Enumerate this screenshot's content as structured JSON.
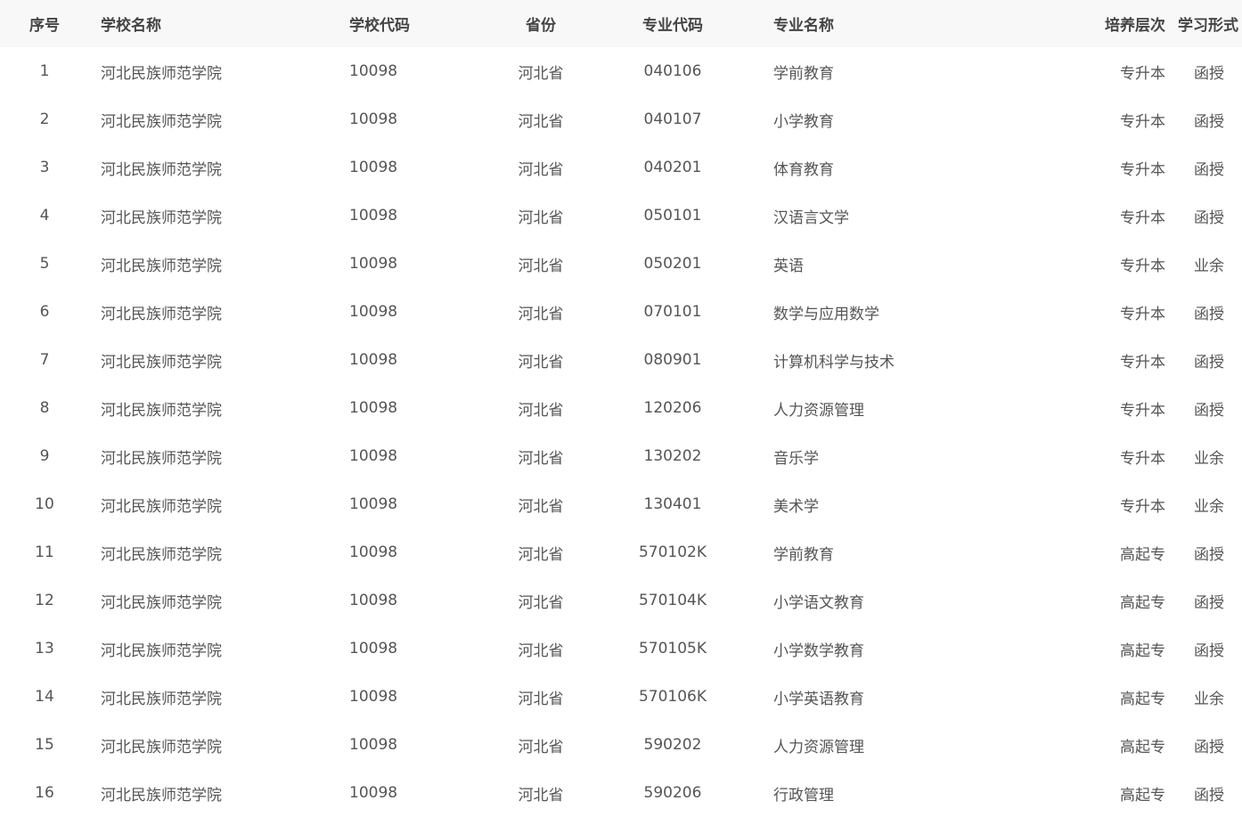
{
  "table": {
    "headers": {
      "index": "序号",
      "school_name": "学校名称",
      "school_code": "学校代码",
      "province": "省份",
      "major_code": "专业代码",
      "major_name": "专业名称",
      "level": "培养层次",
      "study_form": "学习形式"
    },
    "rows": [
      {
        "index": "1",
        "school_name": "河北民族师范学院",
        "school_code": "10098",
        "province": "河北省",
        "major_code": "040106",
        "major_name": "学前教育",
        "level": "专升本",
        "study_form": "函授"
      },
      {
        "index": "2",
        "school_name": "河北民族师范学院",
        "school_code": "10098",
        "province": "河北省",
        "major_code": "040107",
        "major_name": "小学教育",
        "level": "专升本",
        "study_form": "函授"
      },
      {
        "index": "3",
        "school_name": "河北民族师范学院",
        "school_code": "10098",
        "province": "河北省",
        "major_code": "040201",
        "major_name": "体育教育",
        "level": "专升本",
        "study_form": "函授"
      },
      {
        "index": "4",
        "school_name": "河北民族师范学院",
        "school_code": "10098",
        "province": "河北省",
        "major_code": "050101",
        "major_name": "汉语言文学",
        "level": "专升本",
        "study_form": "函授"
      },
      {
        "index": "5",
        "school_name": "河北民族师范学院",
        "school_code": "10098",
        "province": "河北省",
        "major_code": "050201",
        "major_name": "英语",
        "level": "专升本",
        "study_form": "业余"
      },
      {
        "index": "6",
        "school_name": "河北民族师范学院",
        "school_code": "10098",
        "province": "河北省",
        "major_code": "070101",
        "major_name": "数学与应用数学",
        "level": "专升本",
        "study_form": "函授"
      },
      {
        "index": "7",
        "school_name": "河北民族师范学院",
        "school_code": "10098",
        "province": "河北省",
        "major_code": "080901",
        "major_name": "计算机科学与技术",
        "level": "专升本",
        "study_form": "函授"
      },
      {
        "index": "8",
        "school_name": "河北民族师范学院",
        "school_code": "10098",
        "province": "河北省",
        "major_code": "120206",
        "major_name": "人力资源管理",
        "level": "专升本",
        "study_form": "函授"
      },
      {
        "index": "9",
        "school_name": "河北民族师范学院",
        "school_code": "10098",
        "province": "河北省",
        "major_code": "130202",
        "major_name": "音乐学",
        "level": "专升本",
        "study_form": "业余"
      },
      {
        "index": "10",
        "school_name": "河北民族师范学院",
        "school_code": "10098",
        "province": "河北省",
        "major_code": "130401",
        "major_name": "美术学",
        "level": "专升本",
        "study_form": "业余"
      },
      {
        "index": "11",
        "school_name": "河北民族师范学院",
        "school_code": "10098",
        "province": "河北省",
        "major_code": "570102K",
        "major_name": "学前教育",
        "level": "高起专",
        "study_form": "函授"
      },
      {
        "index": "12",
        "school_name": "河北民族师范学院",
        "school_code": "10098",
        "province": "河北省",
        "major_code": "570104K",
        "major_name": "小学语文教育",
        "level": "高起专",
        "study_form": "函授"
      },
      {
        "index": "13",
        "school_name": "河北民族师范学院",
        "school_code": "10098",
        "province": "河北省",
        "major_code": "570105K",
        "major_name": "小学数学教育",
        "level": "高起专",
        "study_form": "函授"
      },
      {
        "index": "14",
        "school_name": "河北民族师范学院",
        "school_code": "10098",
        "province": "河北省",
        "major_code": "570106K",
        "major_name": "小学英语教育",
        "level": "高起专",
        "study_form": "业余"
      },
      {
        "index": "15",
        "school_name": "河北民族师范学院",
        "school_code": "10098",
        "province": "河北省",
        "major_code": "590202",
        "major_name": "人力资源管理",
        "level": "高起专",
        "study_form": "函授"
      },
      {
        "index": "16",
        "school_name": "河北民族师范学院",
        "school_code": "10098",
        "province": "河北省",
        "major_code": "590206",
        "major_name": "行政管理",
        "level": "高起专",
        "study_form": "函授"
      }
    ]
  }
}
